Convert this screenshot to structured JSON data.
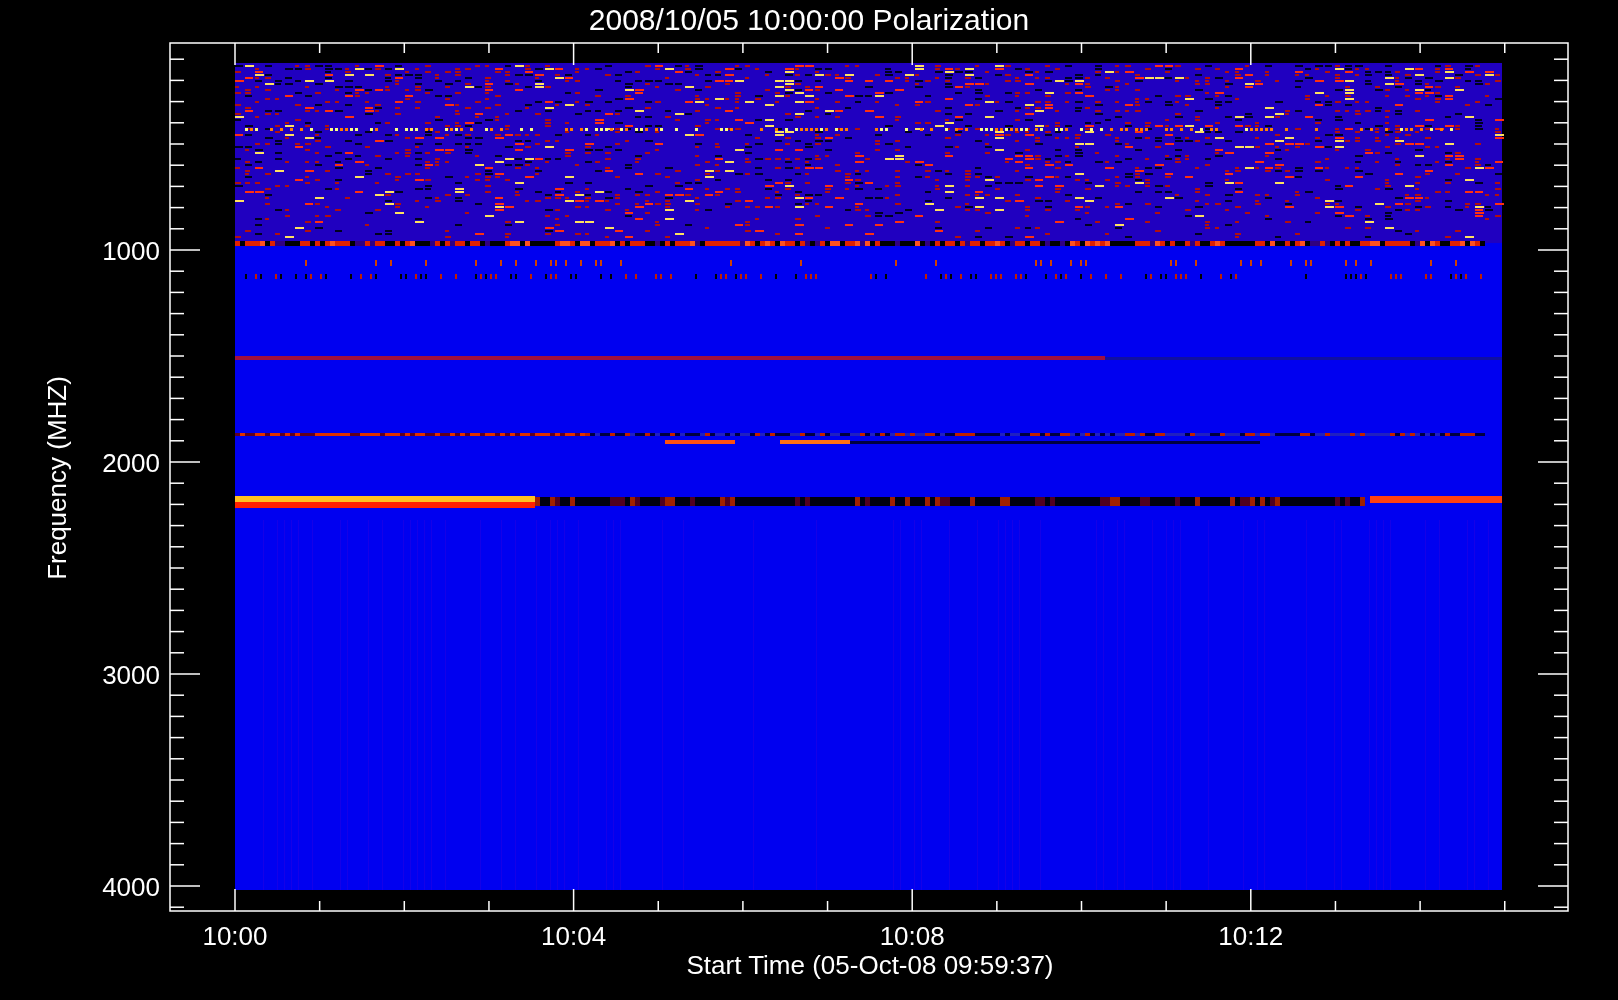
{
  "title": "2008/10/05 10:00:00 Polarization",
  "y_axis": {
    "label": "Frequency (MHZ)",
    "ticks": [
      "1000",
      "2000",
      "3000",
      "4000"
    ]
  },
  "x_axis": {
    "label": "Start Time (05-Oct-08 09:59:37)",
    "ticks": [
      "10:00",
      "10:04",
      "10:08",
      "10:12"
    ]
  }
}
